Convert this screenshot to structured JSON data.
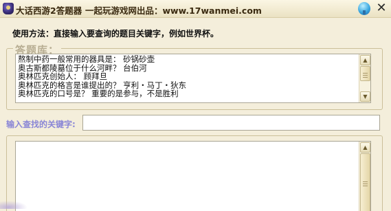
{
  "window": {
    "app_name": "大话西游2答题器",
    "site_line": "一起玩游戏网出品：www.17wanmei.com",
    "icon": "app-logo-icon",
    "pin_icon": "pin-icon",
    "close_glyph": "✕"
  },
  "instruction": "使用方法：直接输入要查询的题目关键字，例如世界杯。",
  "question_bank": {
    "legend": "答题库：",
    "lines": [
      "熬制中药一般常用的器具是：  砂锅砂壶",
      "奥古斯都陵墓位于什么河畔？   台伯河",
      "奥林匹克创始人：    顾拜旦",
      "奥林匹克的格言是谁提出的？  亨利・马丁・狄东",
      "奥林匹克的口号是？    重要的是参与，不是胜利"
    ],
    "scrollbar": {
      "up": "▲",
      "down": "▼"
    }
  },
  "search": {
    "label": "输入查找的关键字:",
    "value": "",
    "placeholder": ""
  },
  "results": {
    "lines": [],
    "scrollbar": {
      "up": "▲"
    }
  },
  "colors": {
    "background": "#f4eedb",
    "legend_text": "#b8ae93",
    "search_label": "#8a86d6"
  }
}
